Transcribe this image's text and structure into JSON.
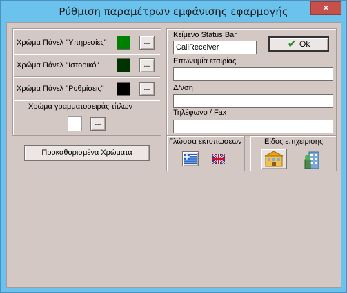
{
  "window": {
    "title": "Ρύθμιση παραμέτρων εμφάνισης εφαρμογής",
    "close_label": "✕"
  },
  "colors": {
    "swatch_services": "#008000",
    "swatch_history": "#003300",
    "swatch_settings": "#000000",
    "swatch_title_font": "#ffffff"
  },
  "left": {
    "rows": [
      {
        "label": "Χρώμα Πάνελ \"Υπηρεσίες\"",
        "button": "..."
      },
      {
        "label": "Χρώμα Πάνελ \"Ιστορικό\"",
        "button": "..."
      },
      {
        "label": "Χρώμα Πάνελ \"Ρυθμίσεις\"",
        "button": "..."
      }
    ],
    "title_font_label": "Χρώμα γραμματοσειράς τίτλων",
    "title_font_button": "...",
    "defaults_button": "Προκαθορισμένα Χρώματα"
  },
  "right": {
    "status_bar_label": "Κείμενο Status Bar",
    "status_bar_value": "CallReceiver",
    "ok_label": "Ok",
    "company_label": "Επωνυμία εταιρίας",
    "company_value": "",
    "address_label": "Δ/νση",
    "address_value": "",
    "phone_label": "Τηλέφωνο / Fax",
    "phone_value": "",
    "print_lang_label": "Γλώσσα εκτυπώσεων",
    "business_type_label": "Είδος επιχείρισης"
  },
  "icons": {
    "greek_flag": "greek-flag-icon",
    "uk_flag": "uk-flag-icon",
    "hotel": "hotel-icon",
    "office_building": "office-building-icon"
  }
}
